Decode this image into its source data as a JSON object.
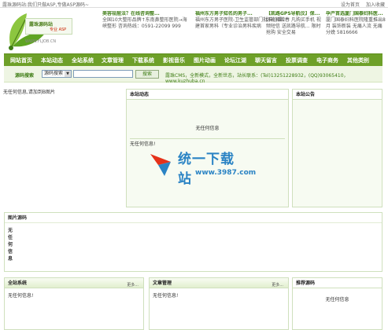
{
  "topbar": {
    "slogan": "露珠源码站:我们只做ASP,专做ASP源码~",
    "set_home": "设为首页",
    "add_favorite": "加入收藏"
  },
  "logo": {
    "name": "露珠源码站",
    "tagline": "专业 ASP",
    "url": "WWW.FLJOB.CN"
  },
  "ads": [
    {
      "title": "美容祛痘法？在线咨询整...",
      "body": "全国10大整形品牌↑东南鼻整形医院→海峡整形 咨询热线：0591-22099 999"
    },
    {
      "title": "福州东方男子知名的男子...",
      "body": "福州东方男子医院-卫生监管部门批准的福建首家男科（专业诊治男科疾病"
    },
    {
      "title": "【凯路GPS导航仪】保...",
      "body": "好礼相赠春 凡购买手机 视频短信 送凯路导航... 限时抢购 安全交易"
    },
    {
      "title": "孕产首选厦门国泰妇科医...",
      "body": "厦门国泰妇科医院隆重推出8月 装饰新装 无痛人流 无痛分娩 5816666"
    }
  ],
  "nav": [
    "网站首页",
    "本站动态",
    "全站系统",
    "文章管理",
    "下载系统",
    "影视音乐",
    "图片动画",
    "论坛江湖",
    "聊天留言",
    "投票调查",
    "电子商务",
    "其他类别"
  ],
  "search": {
    "label": "源码搜索",
    "select_value": "源码搜索",
    "button": "搜索",
    "info": "露珠CMS，全新模式，全新世态，站长联系：(Tel)13251228932，(QQ)93065410，www.kuzhuba.cn"
  },
  "left_empty": "无任何信息,请加到B图片",
  "news": {
    "title": "本站动态",
    "empty_top": "无任何信息",
    "empty_bottom": "无任何信息!"
  },
  "notice": {
    "title": "本站公告"
  },
  "watermark": {
    "brand": "统一下载站",
    "url": "www.3987.com"
  },
  "picsrc": {
    "title": "图片源码",
    "body": "无任何信息"
  },
  "bottom": [
    {
      "title": "全站系统",
      "more": "更多...",
      "empty": "无任何信息!"
    },
    {
      "title": "文章管理",
      "more": "更多...",
      "empty": "无任何信息!"
    },
    {
      "title": "推荐源码",
      "empty": "无任何信息"
    }
  ],
  "colors": {
    "nav_bg": "#6ea029",
    "accent": "#3f7d16",
    "watermark": "#2a83c4"
  }
}
